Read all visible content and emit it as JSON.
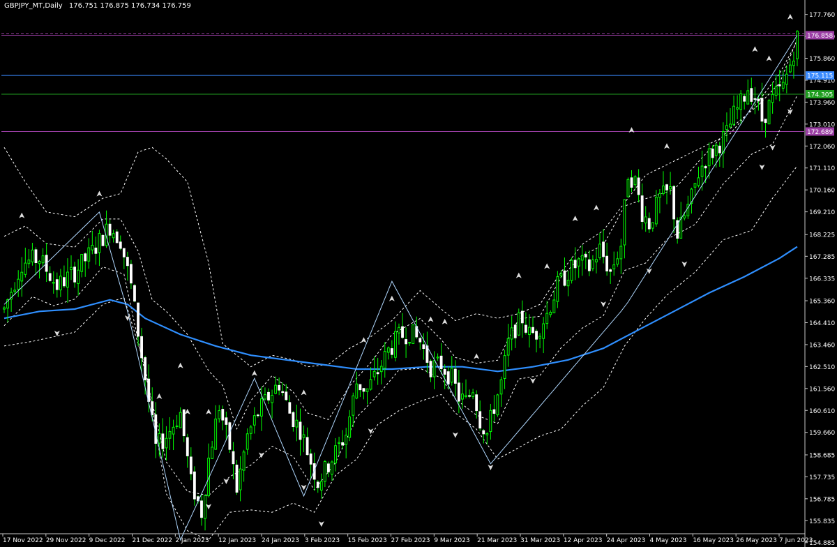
{
  "header": {
    "symbol": "GBPJPY_MT,Daily",
    "ohlc": "176.751 176.875 176.734 176.759"
  },
  "colors": {
    "background": "#000000",
    "bull_candle": "#00ff00",
    "bear_candle": "#ffffff",
    "wick": "#00ff00",
    "moving_average": "#2f8fff",
    "bands": "#ffffff",
    "zigzag": "#b0d8ff",
    "line_175": "#3b8bff",
    "line_174": "#1f9d1f",
    "line_176": "#9b3fa5",
    "line_172": "#9b3fa5"
  },
  "chart_data": {
    "type": "candlestick",
    "ylim": [
      155.3,
      177.9
    ],
    "y_ticks": [
      "177.760",
      "176.810",
      "175.860",
      "174.910",
      "173.960",
      "173.010",
      "172.060",
      "171.110",
      "170.160",
      "169.210",
      "168.225",
      "167.285",
      "166.335",
      "165.360",
      "164.410",
      "163.460",
      "162.510",
      "161.560",
      "160.610",
      "159.660",
      "158.685",
      "157.735",
      "156.785",
      "155.835",
      "154.885"
    ],
    "x_labels": [
      "17 Nov 2022",
      "29 Nov 2022",
      "9 Dec 2022",
      "21 Dec 2022",
      "2 Jan 2023",
      "12 Jan 2023",
      "24 Jan 2023",
      "3 Feb 2023",
      "15 Feb 2023",
      "27 Feb 2023",
      "9 Mar 2023",
      "21 Mar 2023",
      "31 Mar 2023",
      "12 Apr 2023",
      "24 Apr 2023",
      "4 May 2023",
      "16 May 2023",
      "26 May 2023",
      "7 Jun 2023"
    ],
    "price_lines": [
      {
        "label": "176.858",
        "value": 176.858,
        "color": "#9b3fa5",
        "style": "solid"
      },
      {
        "label": "175.115",
        "value": 175.115,
        "color": "#3b8bff",
        "style": "solid"
      },
      {
        "label": "174.305",
        "value": 174.305,
        "color": "#1f9d1f",
        "style": "solid"
      },
      {
        "label": "172.689",
        "value": 172.689,
        "color": "#9b3fa5",
        "style": "solid"
      }
    ],
    "close_path": [
      [
        0,
        165.0
      ],
      [
        5,
        167.0
      ],
      [
        10,
        167.2
      ],
      [
        15,
        166.0
      ],
      [
        20,
        166.6
      ],
      [
        25,
        167.5
      ],
      [
        30,
        168.6
      ],
      [
        33,
        168.0
      ],
      [
        36,
        166.0
      ],
      [
        40,
        162.0
      ],
      [
        43,
        159.0
      ],
      [
        46,
        159.5
      ],
      [
        50,
        160.5
      ],
      [
        53,
        157.5
      ],
      [
        56,
        156.2
      ],
      [
        58,
        158.5
      ],
      [
        61,
        160.8
      ],
      [
        64,
        159.0
      ],
      [
        66,
        157.2
      ],
      [
        69,
        159.5
      ],
      [
        72,
        160.5
      ],
      [
        75,
        161.2
      ],
      [
        78,
        161.8
      ],
      [
        81,
        160.5
      ],
      [
        84,
        159.8
      ],
      [
        87,
        158.4
      ],
      [
        89,
        157.5
      ],
      [
        91,
        158.0
      ],
      [
        94,
        158.8
      ],
      [
        97,
        159.6
      ],
      [
        100,
        161.8
      ],
      [
        103,
        161.5
      ],
      [
        106,
        162.3
      ],
      [
        109,
        163.2
      ],
      [
        112,
        163.8
      ],
      [
        115,
        164.0
      ],
      [
        118,
        163.6
      ],
      [
        121,
        162.5
      ],
      [
        124,
        162.6
      ],
      [
        127,
        162.0
      ],
      [
        129,
        161.2
      ],
      [
        131,
        161.0
      ],
      [
        133,
        161.6
      ],
      [
        135,
        160.2
      ],
      [
        137,
        159.6
      ],
      [
        139,
        160.8
      ],
      [
        141,
        161.8
      ],
      [
        143,
        163.5
      ],
      [
        145,
        164.2
      ],
      [
        147,
        164.6
      ],
      [
        149,
        163.9
      ],
      [
        151,
        164.0
      ],
      [
        154,
        164.8
      ],
      [
        157,
        166.0
      ],
      [
        160,
        166.6
      ],
      [
        163,
        167.0
      ],
      [
        166,
        166.8
      ],
      [
        169,
        167.6
      ],
      [
        172,
        166.6
      ],
      [
        175,
        167.8
      ],
      [
        177,
        170.9
      ],
      [
        179,
        170.5
      ],
      [
        181,
        169.2
      ],
      [
        183,
        168.7
      ],
      [
        186,
        169.8
      ],
      [
        189,
        170.1
      ],
      [
        191,
        168.2
      ],
      [
        193,
        169.0
      ],
      [
        195,
        169.8
      ],
      [
        197,
        170.9
      ],
      [
        199,
        171.5
      ],
      [
        201,
        171.8
      ],
      [
        203,
        172.2
      ],
      [
        205,
        172.6
      ],
      [
        207,
        173.4
      ],
      [
        209,
        173.9
      ],
      [
        211,
        174.6
      ],
      [
        213,
        174.2
      ],
      [
        215,
        173.2
      ],
      [
        217,
        173.8
      ],
      [
        219,
        174.3
      ],
      [
        221,
        174.6
      ],
      [
        223,
        175.6
      ],
      [
        225,
        176.759
      ]
    ],
    "ma_path": [
      [
        0,
        164.6
      ],
      [
        10,
        164.9
      ],
      [
        20,
        165.0
      ],
      [
        30,
        165.4
      ],
      [
        35,
        165.2
      ],
      [
        40,
        164.6
      ],
      [
        50,
        163.9
      ],
      [
        60,
        163.4
      ],
      [
        70,
        163.0
      ],
      [
        80,
        162.8
      ],
      [
        90,
        162.6
      ],
      [
        100,
        162.4
      ],
      [
        110,
        162.4
      ],
      [
        120,
        162.5
      ],
      [
        130,
        162.5
      ],
      [
        140,
        162.3
      ],
      [
        150,
        162.5
      ],
      [
        160,
        162.8
      ],
      [
        170,
        163.3
      ],
      [
        180,
        164.1
      ],
      [
        190,
        164.9
      ],
      [
        200,
        165.7
      ],
      [
        210,
        166.4
      ],
      [
        220,
        167.2
      ],
      [
        225,
        167.7
      ]
    ],
    "upper_band_path": [
      [
        0,
        172.0
      ],
      [
        6,
        170.5
      ],
      [
        12,
        169.2
      ],
      [
        20,
        169.0
      ],
      [
        28,
        169.8
      ],
      [
        33,
        170.0
      ],
      [
        38,
        171.8
      ],
      [
        42,
        172.0
      ],
      [
        46,
        171.5
      ],
      [
        52,
        170.5
      ],
      [
        58,
        167.0
      ],
      [
        62,
        163.5
      ],
      [
        66,
        163.0
      ],
      [
        70,
        162.5
      ],
      [
        76,
        163.0
      ],
      [
        82,
        162.8
      ],
      [
        86,
        162.5
      ],
      [
        92,
        162.6
      ],
      [
        98,
        163.3
      ],
      [
        104,
        163.8
      ],
      [
        110,
        164.5
      ],
      [
        118,
        165.8
      ],
      [
        124,
        165.0
      ],
      [
        128,
        164.5
      ],
      [
        134,
        164.8
      ],
      [
        140,
        164.6
      ],
      [
        146,
        164.8
      ],
      [
        152,
        165.2
      ],
      [
        158,
        166.6
      ],
      [
        164,
        167.8
      ],
      [
        170,
        168.4
      ],
      [
        176,
        169.6
      ],
      [
        182,
        170.8
      ],
      [
        190,
        171.4
      ],
      [
        198,
        172.0
      ],
      [
        206,
        172.6
      ],
      [
        214,
        174.0
      ],
      [
        220,
        175.2
      ],
      [
        225,
        176.6
      ]
    ],
    "lower_band_path": [
      [
        0,
        163.4
      ],
      [
        8,
        163.6
      ],
      [
        14,
        163.8
      ],
      [
        20,
        164.0
      ],
      [
        28,
        165.2
      ],
      [
        34,
        165.5
      ],
      [
        40,
        162.5
      ],
      [
        46,
        157.0
      ],
      [
        52,
        155.4
      ],
      [
        58,
        155.0
      ],
      [
        64,
        156.2
      ],
      [
        70,
        156.3
      ],
      [
        76,
        156.2
      ],
      [
        82,
        156.6
      ],
      [
        88,
        156.2
      ],
      [
        94,
        157.8
      ],
      [
        100,
        158.5
      ],
      [
        106,
        160.0
      ],
      [
        112,
        160.6
      ],
      [
        118,
        161.0
      ],
      [
        124,
        161.3
      ],
      [
        128,
        160.5
      ],
      [
        134,
        159.8
      ],
      [
        140,
        158.5
      ],
      [
        146,
        159.0
      ],
      [
        152,
        159.5
      ],
      [
        158,
        159.8
      ],
      [
        164,
        160.8
      ],
      [
        170,
        161.6
      ],
      [
        176,
        163.4
      ],
      [
        182,
        164.6
      ],
      [
        188,
        165.6
      ],
      [
        196,
        166.6
      ],
      [
        204,
        168.0
      ],
      [
        212,
        168.4
      ],
      [
        218,
        169.8
      ],
      [
        225,
        171.2
      ]
    ],
    "zigzag_path": [
      [
        0,
        165.2
      ],
      [
        27,
        169.2
      ],
      [
        35,
        164.9
      ],
      [
        50,
        155.0
      ],
      [
        71,
        162.0
      ],
      [
        85,
        156.9
      ],
      [
        110,
        166.2
      ],
      [
        138,
        158.3
      ],
      [
        175,
        164.9
      ],
      [
        177,
        165.3
      ],
      [
        225,
        176.858
      ]
    ],
    "up_fractals": [
      5,
      27,
      44,
      50,
      52,
      58,
      71,
      85,
      102,
      110,
      121,
      125,
      134,
      146,
      154,
      162,
      168,
      178,
      188,
      213,
      217,
      223
    ],
    "down_fractals": [
      15,
      35,
      58,
      63,
      73,
      85,
      90,
      104,
      128,
      138,
      150,
      170,
      183,
      193,
      215,
      218,
      223
    ]
  }
}
